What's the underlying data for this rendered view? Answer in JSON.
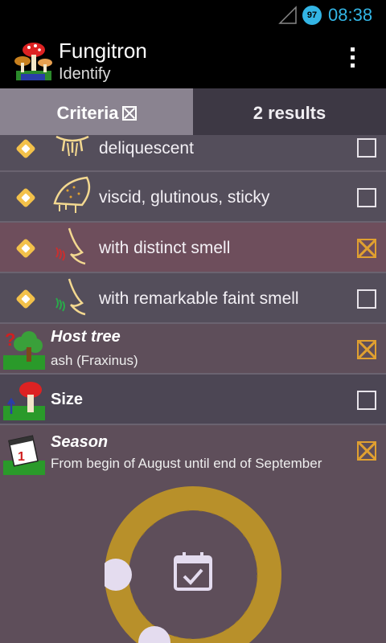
{
  "status": {
    "time": "08:38",
    "battery": "97"
  },
  "app": {
    "title": "Fungitron",
    "subtitle": "Identify"
  },
  "tabs": {
    "criteria": "Criteria",
    "results": "2 results"
  },
  "rows": [
    {
      "label": "deliquescent",
      "checked": false
    },
    {
      "label": "viscid, glutinous, sticky",
      "checked": false
    },
    {
      "label": "with distinct smell",
      "checked": true
    },
    {
      "label": "with remarkable faint smell",
      "checked": false
    }
  ],
  "groups": {
    "host": {
      "title": "Host tree",
      "subtitle": "ash (Fraxinus)",
      "checked": true
    },
    "size": {
      "title": "Size",
      "checked": false
    },
    "season": {
      "title": "Season",
      "subtitle": "From begin of August until end of September",
      "checked": true
    }
  },
  "colors": {
    "accent": "#33b5e5",
    "check": "#e0a030",
    "diamond": "#f3c14a",
    "dial": "#b8902a"
  }
}
